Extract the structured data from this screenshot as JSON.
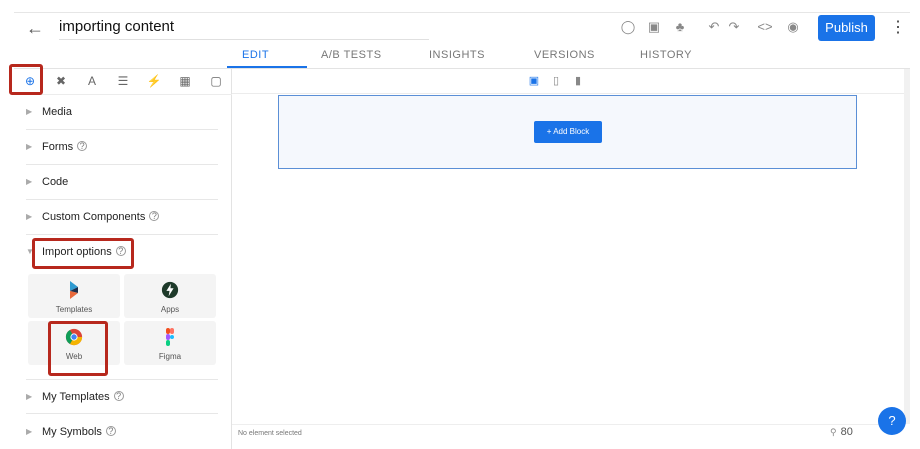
{
  "header": {
    "title": "importing content",
    "publish_label": "Publish",
    "icons": [
      "back-arrow-icon",
      "ab-test-icon",
      "schedule-icon",
      "bell-icon",
      "undo-icon",
      "redo-icon",
      "code-icon",
      "preview-eye-icon",
      "more-vertical-icon"
    ]
  },
  "tabs": [
    {
      "label": "EDIT",
      "active": true
    },
    {
      "label": "A/B TESTS",
      "active": false
    },
    {
      "label": "INSIGHTS",
      "active": false
    },
    {
      "label": "VERSIONS",
      "active": false
    },
    {
      "label": "HISTORY",
      "active": false
    }
  ],
  "sidebar": {
    "top_icons": [
      "add-circle-icon",
      "tools-icon",
      "typography-icon",
      "layers-icon",
      "lightning-icon",
      "database-icon",
      "comment-icon"
    ],
    "sections": [
      {
        "label": "Media",
        "help": false
      },
      {
        "label": "Forms",
        "help": true
      },
      {
        "label": "Code",
        "help": false
      },
      {
        "label": "Custom Components",
        "help": true
      },
      {
        "label": "Import options",
        "help": true
      },
      {
        "label": "My Templates",
        "help": true
      },
      {
        "label": "My Symbols",
        "help": true
      }
    ],
    "import_tiles": [
      {
        "label": "Templates",
        "icon": "builder-logo-icon"
      },
      {
        "label": "Apps",
        "icon": "apps-bolt-icon"
      },
      {
        "label": "Web",
        "icon": "chrome-icon"
      },
      {
        "label": "Figma",
        "icon": "figma-icon"
      }
    ]
  },
  "canvas": {
    "devices": [
      "desktop-icon",
      "tablet-icon",
      "mobile-icon"
    ],
    "add_block_label": "+ Add Block"
  },
  "status": {
    "selection": "No element selected",
    "zoom": "80"
  },
  "colors": {
    "accent": "#1a73e8",
    "annotation": "#b7281d"
  }
}
